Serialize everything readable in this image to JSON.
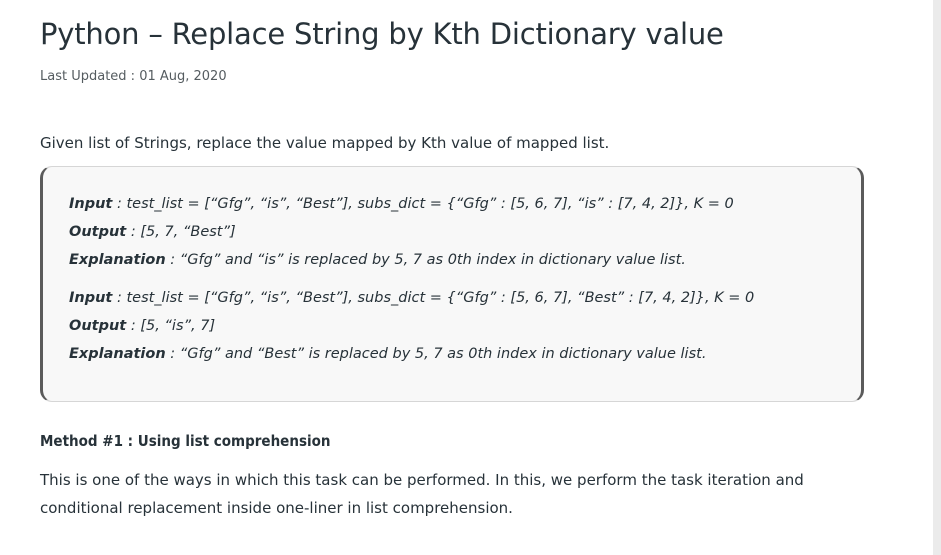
{
  "article": {
    "title": "Python – Replace String by Kth Dictionary value",
    "last_updated": "Last Updated : 01 Aug, 2020",
    "intro": "Given list of Strings, replace the value mapped by Kth value of mapped list."
  },
  "example": {
    "ex1": {
      "input_label": "Input",
      "input_text": " : test_list = [“Gfg”, “is”, “Best”], subs_dict = {“Gfg” : [5, 6, 7], “is” : [7, 4, 2]}, K = 0",
      "output_label": "Output",
      "output_text": " : [5, 7, “Best”]",
      "explanation_label": "Explanation",
      "explanation_text": " : “Gfg” and “is” is replaced by 5, 7 as 0th index in dictionary value list."
    },
    "ex2": {
      "input_label": "Input",
      "input_text": " : test_list = [“Gfg”, “is”, “Best”], subs_dict = {“Gfg” : [5, 6, 7], “Best” : [7, 4, 2]}, K = 0",
      "output_label": "Output",
      "output_text": " : [5, “is”, 7]",
      "explanation_label": "Explanation",
      "explanation_text": " : “Gfg” and “Best” is replaced by 5, 7 as 0th index in dictionary value list."
    }
  },
  "method": {
    "heading": "Method #1 : Using list comprehension",
    "body": "This is one of the ways in which this task can be performed. In this, we perform the task iteration and conditional replacement inside one-liner in list comprehension."
  },
  "colors": {
    "text": "#273239",
    "box_background": "#f8f8f8",
    "box_border_accent": "#5b5b5b"
  }
}
